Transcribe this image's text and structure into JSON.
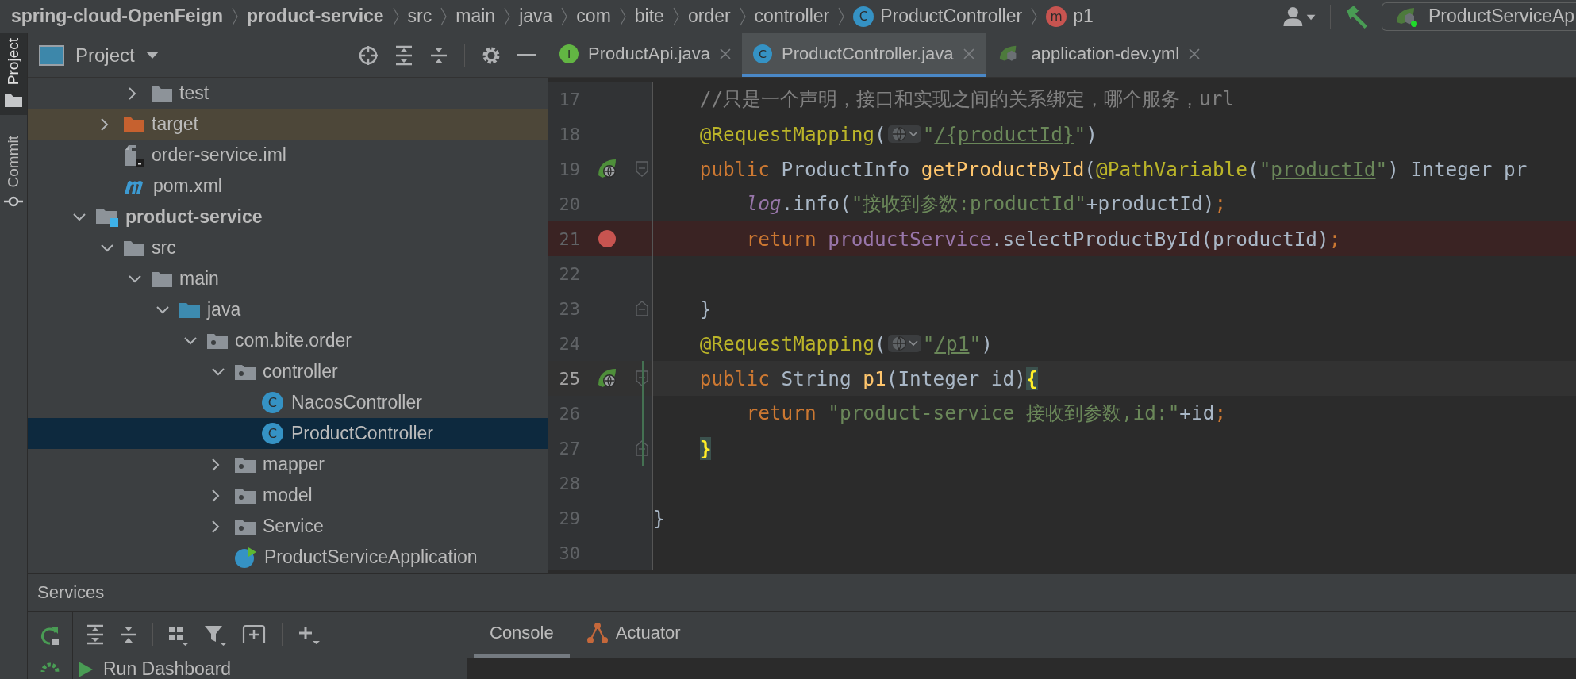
{
  "breadcrumbs": [
    {
      "label": "spring-cloud-OpenFeign",
      "kind": "project"
    },
    {
      "label": "product-service",
      "kind": "module"
    },
    {
      "label": "src",
      "kind": "dir"
    },
    {
      "label": "main",
      "kind": "dir"
    },
    {
      "label": "java",
      "kind": "dir"
    },
    {
      "label": "com",
      "kind": "dir"
    },
    {
      "label": "bite",
      "kind": "dir"
    },
    {
      "label": "order",
      "kind": "dir"
    },
    {
      "label": "controller",
      "kind": "dir"
    },
    {
      "label": "ProductController",
      "kind": "class",
      "badge": "C"
    },
    {
      "label": "p1",
      "kind": "method",
      "badge": "m"
    }
  ],
  "run_config": {
    "label": "ProductServiceAp"
  },
  "side_tabs": [
    {
      "label": "Project",
      "selected": true
    },
    {
      "label": "Commit",
      "selected": false
    }
  ],
  "project": {
    "title": "Project",
    "tree": [
      {
        "children": [
          {
            "children": [
              {
                "label": "test",
                "kind": "folder",
                "expanded": false,
                "selected": false
              }
            ]
          },
          {
            "label": "target",
            "kind": "excluded",
            "expanded": false,
            "selected": false
          },
          {
            "label": "order-service.iml",
            "kind": "iml",
            "selected": false
          },
          {
            "label": "pom.xml",
            "kind": "maven",
            "selected": false
          }
        ]
      },
      {
        "label": "product-service",
        "kind": "module",
        "expanded": true,
        "selected": false,
        "children": [
          {
            "label": "src",
            "kind": "folder",
            "expanded": true,
            "selected": false,
            "children": [
              {
                "label": "main",
                "kind": "folder",
                "expanded": true,
                "selected": false,
                "children": [
                  {
                    "label": "java",
                    "kind": "source",
                    "expanded": true,
                    "selected": false,
                    "children": [
                      {
                        "label": "com.bite.order",
                        "kind": "package",
                        "expanded": true,
                        "selected": false,
                        "children": [
                          {
                            "label": "controller",
                            "kind": "package",
                            "expanded": true,
                            "selected": false,
                            "children": [
                              {
                                "label": "NacosController",
                                "kind": "class",
                                "badge": "C",
                                "selected": false
                              },
                              {
                                "label": "ProductController",
                                "kind": "class",
                                "badge": "C",
                                "selected": true
                              }
                            ]
                          },
                          {
                            "label": "mapper",
                            "kind": "package",
                            "expanded": false,
                            "selected": false
                          },
                          {
                            "label": "model",
                            "kind": "package",
                            "expanded": false,
                            "selected": false
                          },
                          {
                            "label": "Service",
                            "kind": "package",
                            "expanded": false,
                            "selected": false
                          },
                          {
                            "label": "ProductServiceApplication",
                            "kind": "app",
                            "selected": false
                          }
                        ]
                      }
                    ]
                  }
                ]
              }
            ]
          }
        ]
      }
    ]
  },
  "editor": {
    "tabs": [
      {
        "label": "ProductApi.java",
        "kind": "interface",
        "badge": "I",
        "selected": false
      },
      {
        "label": "ProductController.java",
        "kind": "class",
        "badge": "C",
        "selected": true
      },
      {
        "label": "application-dev.yml",
        "kind": "spring",
        "selected": false
      }
    ],
    "lines": [
      {
        "number": "17",
        "tokens": [
          {
            "text": "    //只是一个声明，接口和实现之间的关系绑定，哪个服务，url",
            "kind": "comment"
          }
        ]
      },
      {
        "number": "18",
        "tokens": [
          {
            "text": "    @RequestMapping",
            "kind": "annotation"
          },
          {
            "text": "(",
            "kind": "plain"
          },
          {
            "kind": "inlay"
          },
          {
            "text": "\"",
            "kind": "string"
          },
          {
            "text": "/{productId}",
            "kind": "link"
          },
          {
            "text": "\"",
            "kind": "string"
          },
          {
            "text": ")",
            "kind": "plain"
          }
        ]
      },
      {
        "number": "19",
        "gutter_icon": true,
        "fold_start": true,
        "tokens": [
          {
            "text": "    public ",
            "kind": "keyword"
          },
          {
            "text": "ProductInfo ",
            "kind": "plain"
          },
          {
            "text": "getProductById",
            "kind": "method"
          },
          {
            "text": "(",
            "kind": "plain"
          },
          {
            "text": "@PathVariable",
            "kind": "annotation"
          },
          {
            "text": "(",
            "kind": "plain"
          },
          {
            "text": "\"",
            "kind": "string"
          },
          {
            "text": "productId",
            "kind": "link"
          },
          {
            "text": "\"",
            "kind": "string"
          },
          {
            "text": ") Integer pr",
            "kind": "plain"
          }
        ]
      },
      {
        "number": "20",
        "tokens": [
          {
            "text": "        log",
            "kind": "static"
          },
          {
            "text": ".info(",
            "kind": "plain"
          },
          {
            "text": "\"接收到参数:productId\"",
            "kind": "string"
          },
          {
            "text": "+productId)",
            "kind": "plain"
          },
          {
            "text": ";",
            "kind": "keyword"
          }
        ]
      },
      {
        "number": "21",
        "breakpoint": true,
        "tokens": [
          {
            "text": "        return ",
            "kind": "keyword"
          },
          {
            "text": "productService",
            "kind": "field"
          },
          {
            "text": ".selectProductById(productId)",
            "kind": "plain"
          },
          {
            "text": ";",
            "kind": "keyword"
          }
        ]
      },
      {
        "number": "22"
      },
      {
        "number": "23",
        "fold_end": true,
        "tokens": [
          {
            "text": "    }",
            "kind": "plain"
          }
        ]
      },
      {
        "number": "24",
        "tokens": [
          {
            "text": "    @RequestMapping",
            "kind": "annotation"
          },
          {
            "text": "(",
            "kind": "plain"
          },
          {
            "kind": "inlay"
          },
          {
            "text": "\"",
            "kind": "string"
          },
          {
            "text": "/p1",
            "kind": "link"
          },
          {
            "text": "\"",
            "kind": "string"
          },
          {
            "text": ")",
            "kind": "plain"
          }
        ]
      },
      {
        "number": "25",
        "gutter_icon": true,
        "fold_start": true,
        "current": true,
        "changed": true,
        "tokens": [
          {
            "text": "    public ",
            "kind": "keyword"
          },
          {
            "text": "String ",
            "kind": "plain"
          },
          {
            "text": "p1",
            "kind": "method"
          },
          {
            "text": "(Integer id)",
            "kind": "plain"
          },
          {
            "text": "{",
            "kind": "brace"
          }
        ]
      },
      {
        "number": "26",
        "changed": true,
        "tokens": [
          {
            "text": "        return ",
            "kind": "keyword"
          },
          {
            "text": "\"product-service 接收到参数,id:\"",
            "kind": "string"
          },
          {
            "text": "+id",
            "kind": "plain"
          },
          {
            "text": ";",
            "kind": "keyword"
          }
        ]
      },
      {
        "number": "27",
        "fold_end": true,
        "changed": true,
        "tokens": [
          {
            "text": "    }",
            "kind": "brace"
          }
        ]
      },
      {
        "number": "28"
      },
      {
        "number": "29",
        "tokens": [
          {
            "text": "}",
            "kind": "plain"
          }
        ]
      },
      {
        "number": "30"
      }
    ]
  },
  "services": {
    "title": "Services",
    "tree": [
      {
        "label": "Run Dashboard"
      }
    ],
    "tabs": [
      {
        "label": "Console",
        "kind": "console",
        "selected": true
      },
      {
        "label": "Actuator",
        "kind": "actuator",
        "selected": false
      }
    ]
  }
}
